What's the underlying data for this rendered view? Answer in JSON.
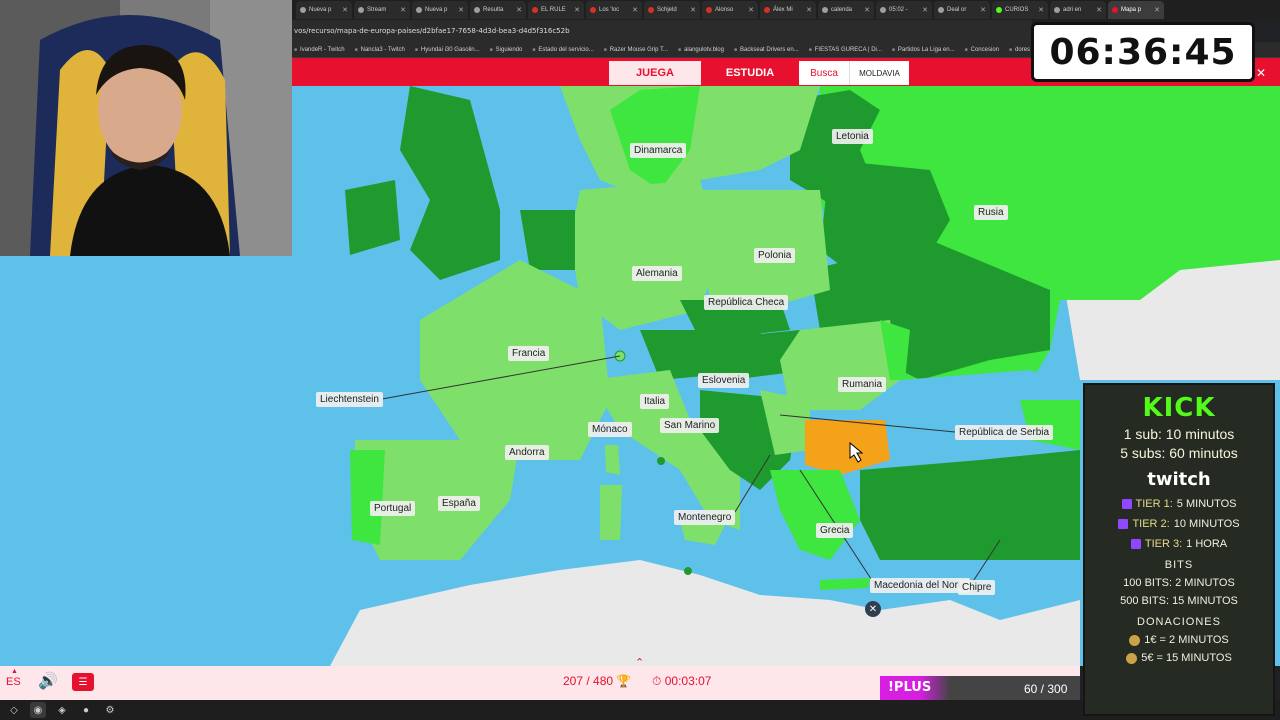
{
  "browser": {
    "tabs": [
      {
        "label": "Nueva p",
        "color": "#9aa0a6"
      },
      {
        "label": "Stream",
        "color": "#9aa0a6"
      },
      {
        "label": "Nueva p",
        "color": "#9aa0a6"
      },
      {
        "label": "Resulta",
        "color": "#9aa0a6"
      },
      {
        "label": "EL RULE",
        "color": "#d93025"
      },
      {
        "label": "Los 'loc",
        "color": "#d93025"
      },
      {
        "label": "Schjeld",
        "color": "#d93025"
      },
      {
        "label": "Alonso",
        "color": "#d93025"
      },
      {
        "label": "Álex Mi",
        "color": "#d93025"
      },
      {
        "label": "calenda",
        "color": "#9aa0a6"
      },
      {
        "label": "05:02 -",
        "color": "#9aa0a6"
      },
      {
        "label": "Deal or",
        "color": "#9aa0a6"
      },
      {
        "label": "CURIOS",
        "color": "#53fc18"
      },
      {
        "label": "adri en",
        "color": "#9aa0a6"
      },
      {
        "label": "Mapa p",
        "color": "#e8102f",
        "active": true
      }
    ],
    "url": "vos/recurso/mapa-de-europa-paises/d2bfae17-7658-4d3d-bea3-d4d5f316c52b",
    "bookmarks": [
      "IvandeR - Twitch",
      "Nancla3 - Twitch",
      "Hyundai i30 Gasolin...",
      "Siguiendo",
      "Estado del servicio...",
      "Razer Mouse Grip T...",
      "alangulotv.blog",
      "Backseat Drivers en...",
      "FIESTAS GURECA | Di...",
      "Partidos La Liga en...",
      "Concesion",
      "dores"
    ]
  },
  "site": {
    "nav": {
      "juega": "JUEGA",
      "estudia": "ESTUDIA",
      "busca": "Busca",
      "target": "MOLDAVIA"
    },
    "close": "✕"
  },
  "map": {
    "labels": {
      "dinamarca": "Dinamarca",
      "letonia": "Letonia",
      "rusia": "Rusia",
      "polonia": "Polonia",
      "alemania": "Alemania",
      "republica_checa": "República Checa",
      "francia": "Francia",
      "liechtenstein": "Liechtenstein",
      "eslovenia": "Eslovenia",
      "rumania": "Rumania",
      "italia": "Italia",
      "monaco": "Mónaco",
      "san_marino": "San Marino",
      "republica_serbia": "República de Serbia",
      "andorra": "Andorra",
      "portugal": "Portugal",
      "espana": "España",
      "montenegro": "Montenegro",
      "grecia": "Grecia",
      "macedonia": "Macedonia del Norte",
      "chipre": "Chipre"
    },
    "colors": {
      "sea": "#5ec1ea",
      "found": "#3fe63f",
      "found_light": "#7ee06a",
      "found_dark": "#1f9a2e",
      "highlight": "#f5a21b",
      "unknown": "#e9e9e9"
    }
  },
  "bottom": {
    "lang": "ES",
    "score": "207 / 480",
    "timer": "00:03:07"
  },
  "stream": {
    "timer": "06:36:45",
    "kick": {
      "title": "KICK",
      "line1": "1 sub: 10 minutos",
      "line2": "5 subs: 60 minutos"
    },
    "twitch": {
      "title": "twitch",
      "tiers": [
        {
          "tier": "TIER 1:",
          "value": "5 MINUTOS"
        },
        {
          "tier": "TIER 2:",
          "value": "10 MINUTOS"
        },
        {
          "tier": "TIER 3:",
          "value": "1 HORA"
        }
      ]
    },
    "bits": {
      "title": "BITS",
      "line1": "100 BITS: 2 MINUTOS",
      "line2": "500 BITS: 15 MINUTOS"
    },
    "donaciones": {
      "title": "DONACIONES",
      "line1": "1€ = 2 MINUTOS",
      "line2": "5€ = 15 MINUTOS"
    },
    "goal": {
      "label": "!PLUS",
      "count": "60 / 300",
      "progress": 0.2
    }
  }
}
